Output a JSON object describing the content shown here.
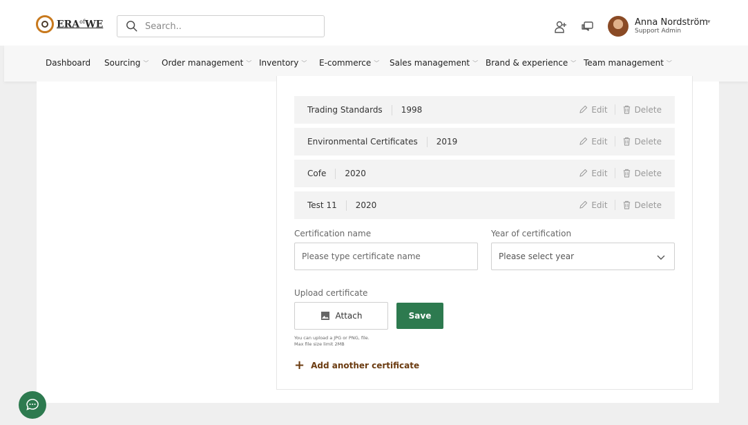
{
  "brand": {
    "logo_text": "ERA",
    "logo_sup": "of",
    "logo_text2": "WE"
  },
  "search": {
    "placeholder": "Search.."
  },
  "user": {
    "name": "Anna Nordström",
    "role": "Support Admin"
  },
  "nav": {
    "items": [
      {
        "label": "Dashboard",
        "has_dropdown": false
      },
      {
        "label": "Sourcing",
        "has_dropdown": true
      },
      {
        "label": "Order management",
        "has_dropdown": true
      },
      {
        "label": "Inventory",
        "has_dropdown": true
      },
      {
        "label": "E-commerce",
        "has_dropdown": true
      },
      {
        "label": "Sales management",
        "has_dropdown": true
      },
      {
        "label": "Brand & experience",
        "has_dropdown": true
      },
      {
        "label": "Team management",
        "has_dropdown": true
      }
    ]
  },
  "certificates": [
    {
      "name": "Trading Standards",
      "year": "1998",
      "edit_label": "Edit",
      "delete_label": "Delete"
    },
    {
      "name": "Environmental Certificates",
      "year": "2019",
      "edit_label": "Edit",
      "delete_label": "Delete"
    },
    {
      "name": "Cofe",
      "year": "2020",
      "edit_label": "Edit",
      "delete_label": "Delete"
    },
    {
      "name": "Test 11",
      "year": "2020",
      "edit_label": "Edit",
      "delete_label": "Delete"
    }
  ],
  "form": {
    "cert_name_label": "Certification name",
    "cert_name_placeholder": "Please type certificate name",
    "year_label": "Year of certification",
    "year_placeholder": "Please select year",
    "upload_label": "Upload certificate",
    "attach_label": "Attach",
    "save_label": "Save",
    "hint_line1": "You can upload a JPG or PNG, file.",
    "hint_line2": "Max file size limit 2MB",
    "add_another_label": "Add another certificate"
  },
  "colors": {
    "primary_green": "#2d7a4f",
    "accent_brown": "#6b3b10",
    "logo_orange": "#c8791d"
  }
}
